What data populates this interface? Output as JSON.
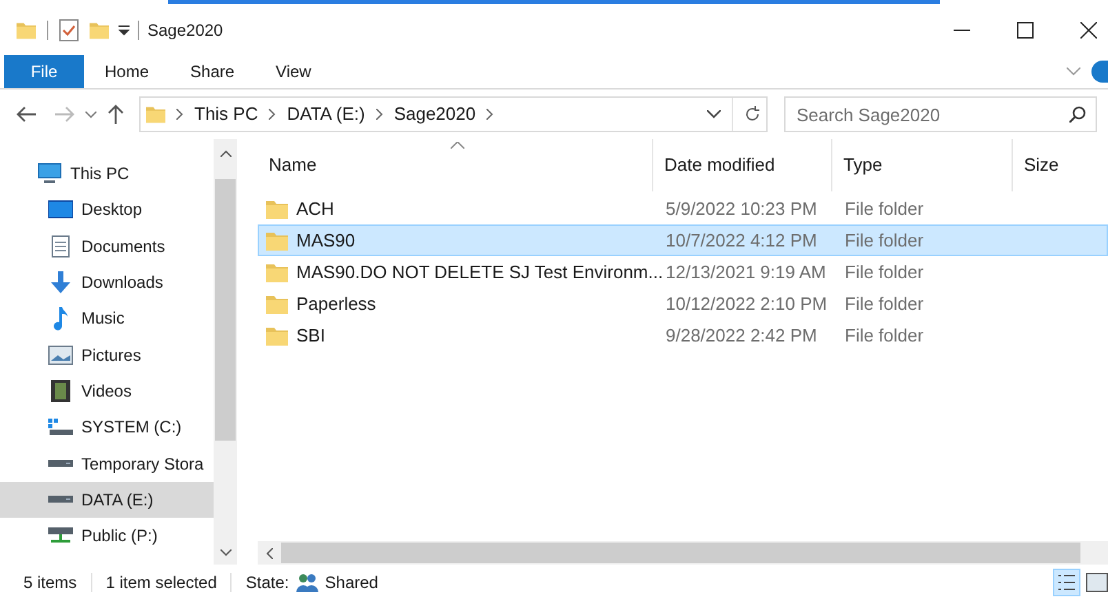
{
  "window": {
    "title": "Sage2020"
  },
  "ribbon_tabs": [
    {
      "label": "File",
      "kind": "file"
    },
    {
      "label": "Home",
      "kind": "tab"
    },
    {
      "label": "Share",
      "kind": "tab"
    },
    {
      "label": "View",
      "kind": "tab"
    }
  ],
  "address": {
    "crumbs": [
      "This PC",
      "DATA (E:)",
      "Sage2020"
    ]
  },
  "search": {
    "placeholder": "Search Sage2020"
  },
  "sidebar": {
    "items": [
      {
        "label": "This PC",
        "kind": "pc",
        "selected": false,
        "children": [
          {
            "label": "Desktop",
            "kind": "desktop",
            "selected": false
          },
          {
            "label": "Documents",
            "kind": "documents",
            "selected": false
          },
          {
            "label": "Downloads",
            "kind": "downloads",
            "selected": false
          },
          {
            "label": "Music",
            "kind": "music",
            "selected": false
          },
          {
            "label": "Pictures",
            "kind": "pictures",
            "selected": false
          },
          {
            "label": "Videos",
            "kind": "videos",
            "selected": false
          },
          {
            "label": "SYSTEM (C:)",
            "kind": "system",
            "selected": false
          },
          {
            "label": "Temporary Stora",
            "kind": "drive",
            "selected": false
          },
          {
            "label": "DATA (E:)",
            "kind": "drive",
            "selected": true
          },
          {
            "label": "Public (P:)",
            "kind": "network",
            "selected": false
          }
        ]
      }
    ]
  },
  "table": {
    "columns": [
      "Name",
      "Date modified",
      "Type",
      "Size"
    ],
    "rows": [
      {
        "name": "ACH",
        "date": "5/9/2022 10:23 PM",
        "type": "File folder",
        "selected": false
      },
      {
        "name": "MAS90",
        "date": "10/7/2022 4:12 PM",
        "type": "File folder",
        "selected": true
      },
      {
        "name": "MAS90.DO NOT DELETE SJ Test Environm...",
        "date": "12/13/2021 9:19 AM",
        "type": "File folder",
        "selected": false
      },
      {
        "name": "Paperless",
        "date": "10/12/2022 2:10 PM",
        "type": "File folder",
        "selected": false
      },
      {
        "name": "SBI",
        "date": "9/28/2022 2:42 PM",
        "type": "File folder",
        "selected": false
      }
    ]
  },
  "status_bar": {
    "count": "5 items",
    "selection": "1 item selected",
    "state_label": "State:",
    "state_value": "Shared"
  }
}
